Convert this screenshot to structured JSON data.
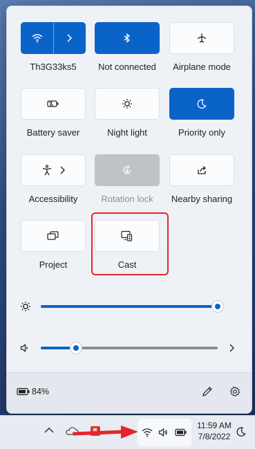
{
  "quick_settings": {
    "tiles": [
      {
        "id": "wifi",
        "label": "Th3G33ks5",
        "state": "on",
        "icon": "wifi-icon",
        "secondary_icon": "chevron-right-icon"
      },
      {
        "id": "bluetooth",
        "label": "Not connected",
        "state": "on",
        "icon": "bluetooth-icon"
      },
      {
        "id": "airplane",
        "label": "Airplane mode",
        "state": "off",
        "icon": "airplane-icon"
      },
      {
        "id": "battery-saver",
        "label": "Battery saver",
        "state": "off",
        "icon": "battery-saver-icon"
      },
      {
        "id": "night-light",
        "label": "Night light",
        "state": "off",
        "icon": "night-light-icon"
      },
      {
        "id": "priority",
        "label": "Priority only",
        "state": "on",
        "icon": "moon-icon"
      },
      {
        "id": "accessibility",
        "label": "Accessibility",
        "state": "off",
        "icon": "accessibility-icon",
        "secondary_icon": "chevron-right-icon"
      },
      {
        "id": "rotation-lock",
        "label": "Rotation lock",
        "state": "disabled",
        "icon": "rotation-lock-icon"
      },
      {
        "id": "nearby-sharing",
        "label": "Nearby sharing",
        "state": "off",
        "icon": "share-icon"
      },
      {
        "id": "project",
        "label": "Project",
        "state": "off",
        "icon": "project-icon"
      },
      {
        "id": "cast",
        "label": "Cast",
        "state": "off",
        "icon": "cast-icon",
        "highlighted": true
      }
    ],
    "brightness": {
      "icon": "sun-icon",
      "level": 1.0
    },
    "volume": {
      "icon": "speaker-icon",
      "level": 0.2,
      "more_icon": "chevron-right-icon"
    },
    "footer": {
      "battery_text": "84%",
      "battery_icon": "battery-icon",
      "edit_icon": "pencil-icon",
      "settings_icon": "gear-icon"
    }
  },
  "taskbar": {
    "time": "11:59 AM",
    "date": "7/8/2022",
    "icons": [
      "chevron-up-icon",
      "onedrive-icon",
      "office-icon",
      "wifi-icon",
      "speaker-icon",
      "battery-icon",
      "moon-icon"
    ]
  },
  "colors": {
    "accent": "#0a63c9",
    "highlight": "#e5242b"
  }
}
